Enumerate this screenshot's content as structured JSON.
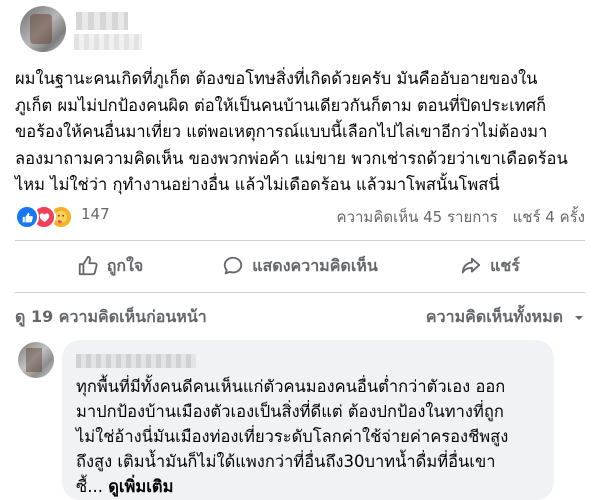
{
  "post": {
    "lines": [
      "ผมในฐานะคนเกิดที่ภูเก็ต ต้องขอโทษสิ่งที่เกิดด้วยครับ มันคืออับอายของใน",
      "ภูเก็ต ผมไม่ปกป้องคนผิด ต่อให้เป็นคนบ้านเดียวกันก็ตาม ตอนที่ปิดประเทศก็",
      "ขอร้องให้คนอื่นมาเที่ยว แต่พอเหตุการณ์แบบนี้เลือกไปไล่เขาอีกว่าไม่ต้องมา",
      "ลองมาถามความคิดเห็น ของพวกพ่อค้า แม่ขาย พวกเช่ารถด้วยว่าเขาเดือดร้อน",
      "ไหม ไม่ใช่ว่า กุทำงานอย่างอื่น แล้วไม่เดือดร้อน แล้วมาโพสนั้นโพสนี่"
    ]
  },
  "reactions": {
    "icons": [
      "like-icon",
      "love-icon",
      "care-icon"
    ],
    "count": "147",
    "comments": "ความคิดเห็น 45 รายการ",
    "shares": "แชร์ 4 ครั้ง"
  },
  "actions": {
    "like": "ถูกใจ",
    "comment": "แสดงความคิดเห็น",
    "share": "แชร์"
  },
  "comments_header": {
    "view_previous": "ดู 19 ความคิดเห็นก่อนหน้า",
    "sort": "ความคิดเห็นทั้งหมด"
  },
  "comment": {
    "lines": [
      "ทุกพื้นที่มีทั้งคนดีคนเห็นแก่ตัวคนมองคนอื่นต่ำกว่าตัวเอง ออก",
      "มาปกป้องบ้านเมืองตัวเองเป็นสิ่งที่ดีแต่ ต้องปกป้องในทางที่ถูก",
      "ไม่ใช่อ้างนี่มันเมืองท่องเที่ยวระดับโลกค่าใช้จ่ายค่าครองชีพสูง",
      "ถึงสูง เติมน้ำมันก็ไม่ใด้แพงกว่าที่อื่นถึง30บาทน้ำดื่มที่อื่นเขา"
    ],
    "last_line_prefix": "ซื้...",
    "see_more": "ดูเพิ่มเติม"
  },
  "colors": {
    "text": "#050505",
    "secondary": "#65676b",
    "like_blue": "#1877f2",
    "love_red": "#f33e58",
    "care_yellow": "#f7b125",
    "bubble_bg": "#f0f2f5"
  }
}
